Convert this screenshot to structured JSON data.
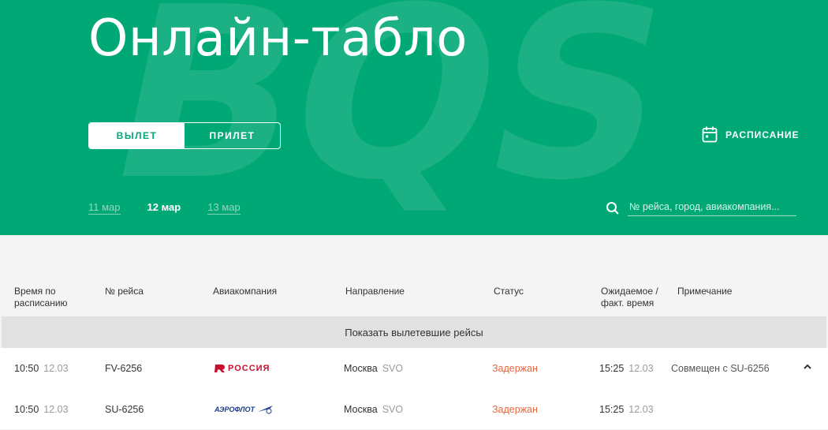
{
  "hero": {
    "watermark": "BQS",
    "title": "Онлайн-табло",
    "tabs": [
      "ВЫЛЕТ",
      "ПРИЛЕТ"
    ],
    "active_tab": 0,
    "schedule_label": "РАСПИСАНИЕ",
    "dates": [
      "11 мар",
      "12 мар",
      "13 мар"
    ],
    "active_date": 1,
    "search_placeholder": "№ рейса, город, авиакомпания..."
  },
  "colors": {
    "brand": "#00a875",
    "status_delayed": "#e8663d"
  },
  "table": {
    "columns": [
      "Время по расписанию",
      "№ рейса",
      "Авиакомпания",
      "Направление",
      "Статус",
      "Ожидаемое / факт. время",
      "Примечание"
    ],
    "show_departed_label": "Показать вылетевшие рейсы",
    "rows": [
      {
        "time": "10:50",
        "date": "12.03",
        "flight": "FV-6256",
        "airline": "РОССИЯ",
        "airline_icon": "rossiya-logo-icon",
        "city": "Москва",
        "airport": "SVO",
        "status": "Задержан",
        "exp_time": "15:25",
        "exp_date": "12.03",
        "note": "Совмещен с SU-6256"
      },
      {
        "time": "10:50",
        "date": "12.03",
        "flight": "SU-6256",
        "airline": "АЭРОФЛОТ",
        "airline_icon": "aeroflot-logo-icon",
        "city": "Москва",
        "airport": "SVO",
        "status": "Задержан",
        "exp_time": "15:25",
        "exp_date": "12.03",
        "note": ""
      }
    ]
  }
}
